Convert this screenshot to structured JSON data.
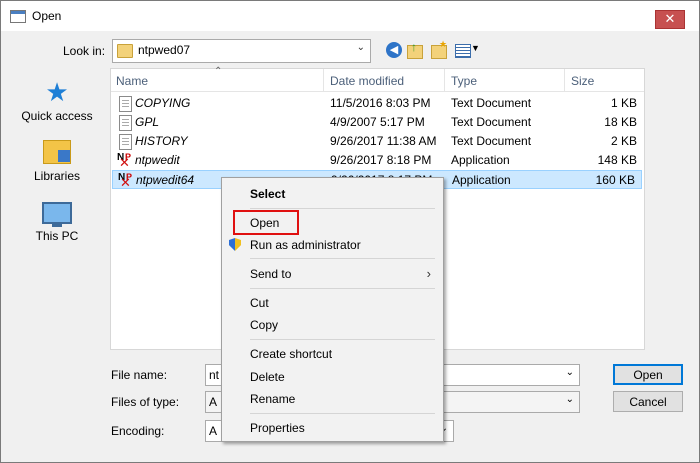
{
  "window": {
    "title": "Open",
    "close": "✕"
  },
  "lookin": {
    "label": "Look in:",
    "value": "ntpwed07"
  },
  "places": [
    {
      "label": "Quick access",
      "icon": "star-icon"
    },
    {
      "label": "Libraries",
      "icon": "libraries-icon"
    },
    {
      "label": "This PC",
      "icon": "this-pc-icon"
    }
  ],
  "columns": {
    "name": "Name",
    "date": "Date modified",
    "type": "Type",
    "size": "Size"
  },
  "files": [
    {
      "name": "COPYING",
      "date": "11/5/2016 8:03 PM",
      "type": "Text Document",
      "size": "1 KB",
      "icon": "text-document-icon"
    },
    {
      "name": "GPL",
      "date": "4/9/2007 5:17 PM",
      "type": "Text Document",
      "size": "18 KB",
      "icon": "text-document-icon"
    },
    {
      "name": "HISTORY",
      "date": "9/26/2017 11:38 AM",
      "type": "Text Document",
      "size": "2 KB",
      "icon": "text-document-icon"
    },
    {
      "name": "ntpwedit",
      "date": "9/26/2017 8:18 PM",
      "type": "Application",
      "size": "148 KB",
      "icon": "application-icon"
    },
    {
      "name": "ntpwedit64",
      "date": "9/26/2017 8:17 PM",
      "type": "Application",
      "size": "160 KB",
      "icon": "application-icon",
      "selected": true
    }
  ],
  "bottom": {
    "filename_label": "File name:",
    "filename_value": "nt",
    "filetype_label": "Files of type:",
    "filetype_value": "A",
    "encoding_label": "Encoding:",
    "encoding_value": "A",
    "open_button": "Open",
    "cancel_button": "Cancel"
  },
  "context_menu": {
    "select": "Select",
    "open": "Open",
    "run_as_admin": "Run as administrator",
    "send_to": "Send to",
    "cut": "Cut",
    "copy": "Copy",
    "create_shortcut": "Create shortcut",
    "delete": "Delete",
    "rename": "Rename",
    "properties": "Properties"
  },
  "colors": {
    "selection": "#cce8ff",
    "highlight_box": "#e01010",
    "accent": "#0078d7"
  }
}
